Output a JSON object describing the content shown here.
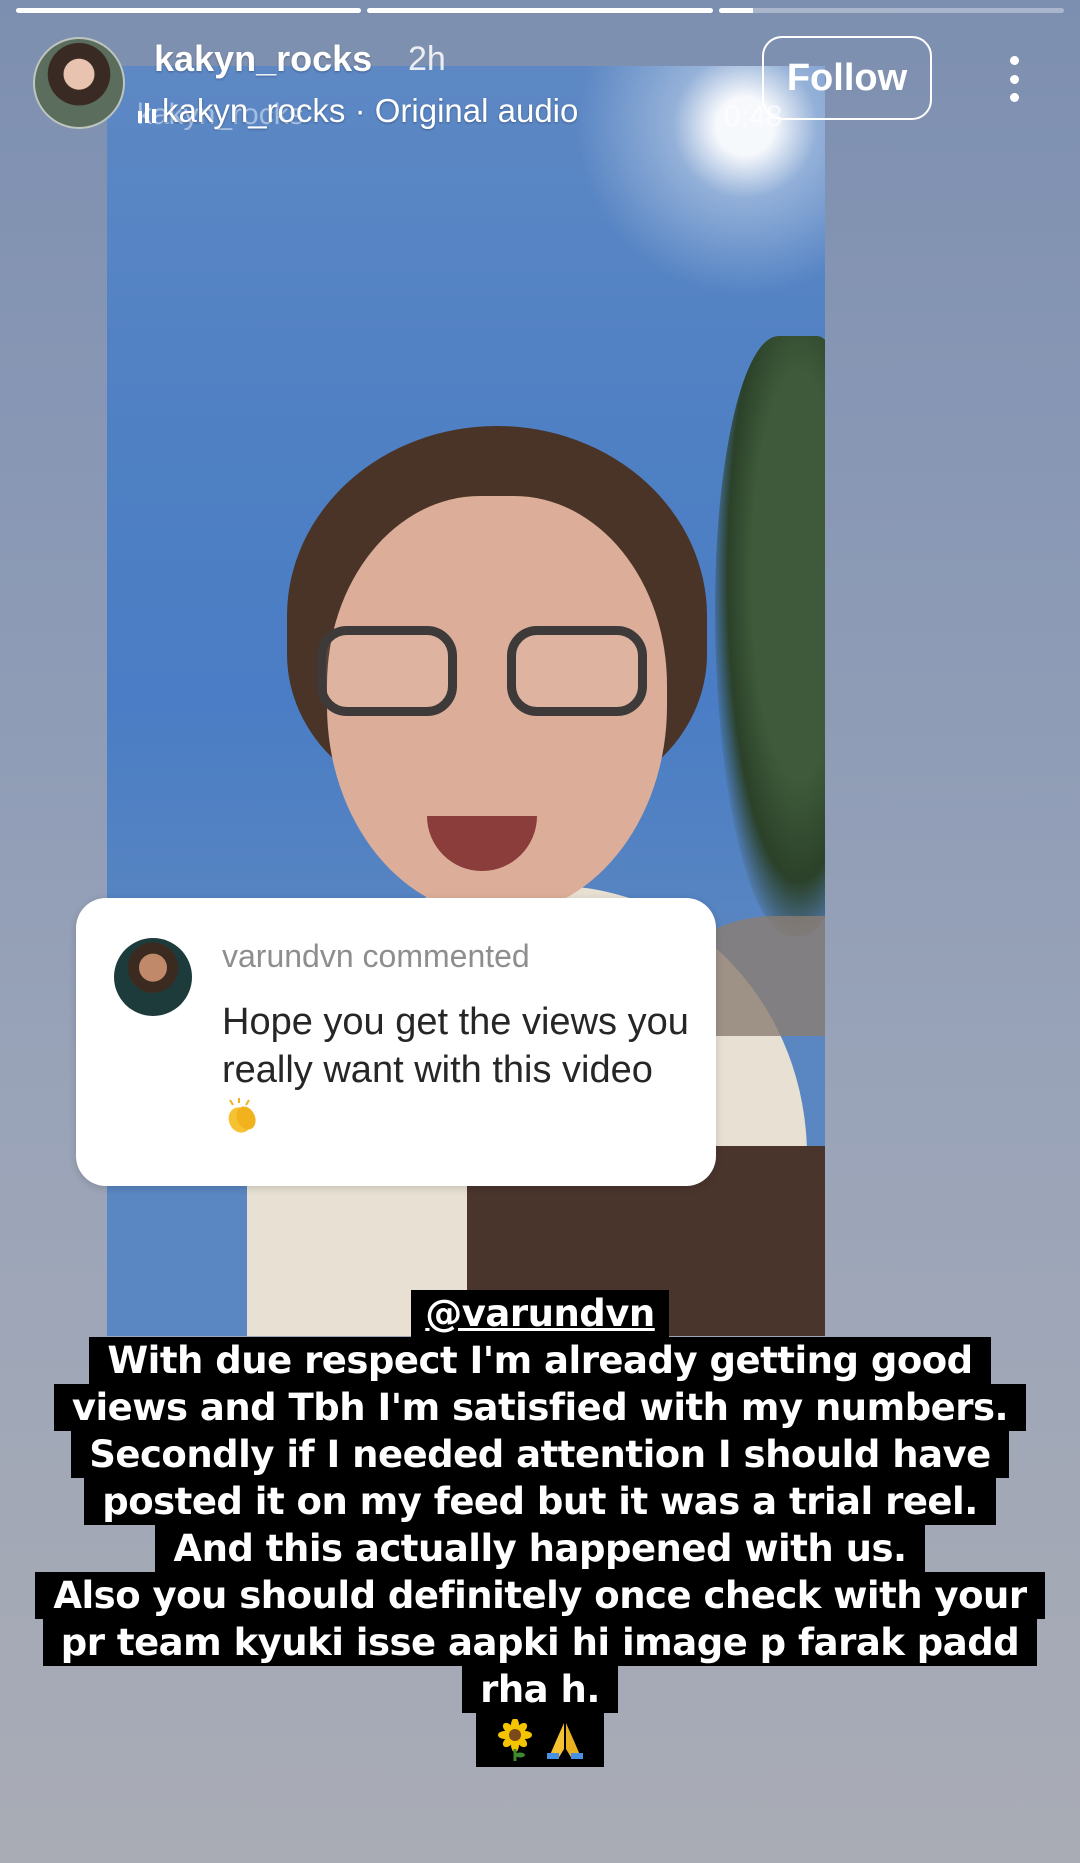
{
  "story": {
    "progress_segments": [
      1,
      1,
      0.1
    ]
  },
  "header": {
    "username": "kakyn_rocks",
    "time_ago": "2h",
    "audio_label": "kakyn_rocks · Original audio",
    "ghost_username": "kakyn_rocks",
    "follow_label": "Follow",
    "video_timestamp": "0:48"
  },
  "comment": {
    "commenter_label": "varundvn commented",
    "text": "Hope you get the views you really want with this video"
  },
  "caption": {
    "mention": "@varundvn",
    "lines": [
      "With due respect I'm already getting good",
      "views and Tbh I'm satisfied with my numbers.",
      "Secondly if I needed attention I should have",
      "posted it on my feed but it was a trial reel.",
      "And this actually happened with us.",
      "Also you should definitely once check with your",
      "pr team kyuki isse aapki hi image p farak padd",
      "rha h."
    ],
    "emojis": [
      "sunflower-icon",
      "folded-hands-icon"
    ]
  }
}
